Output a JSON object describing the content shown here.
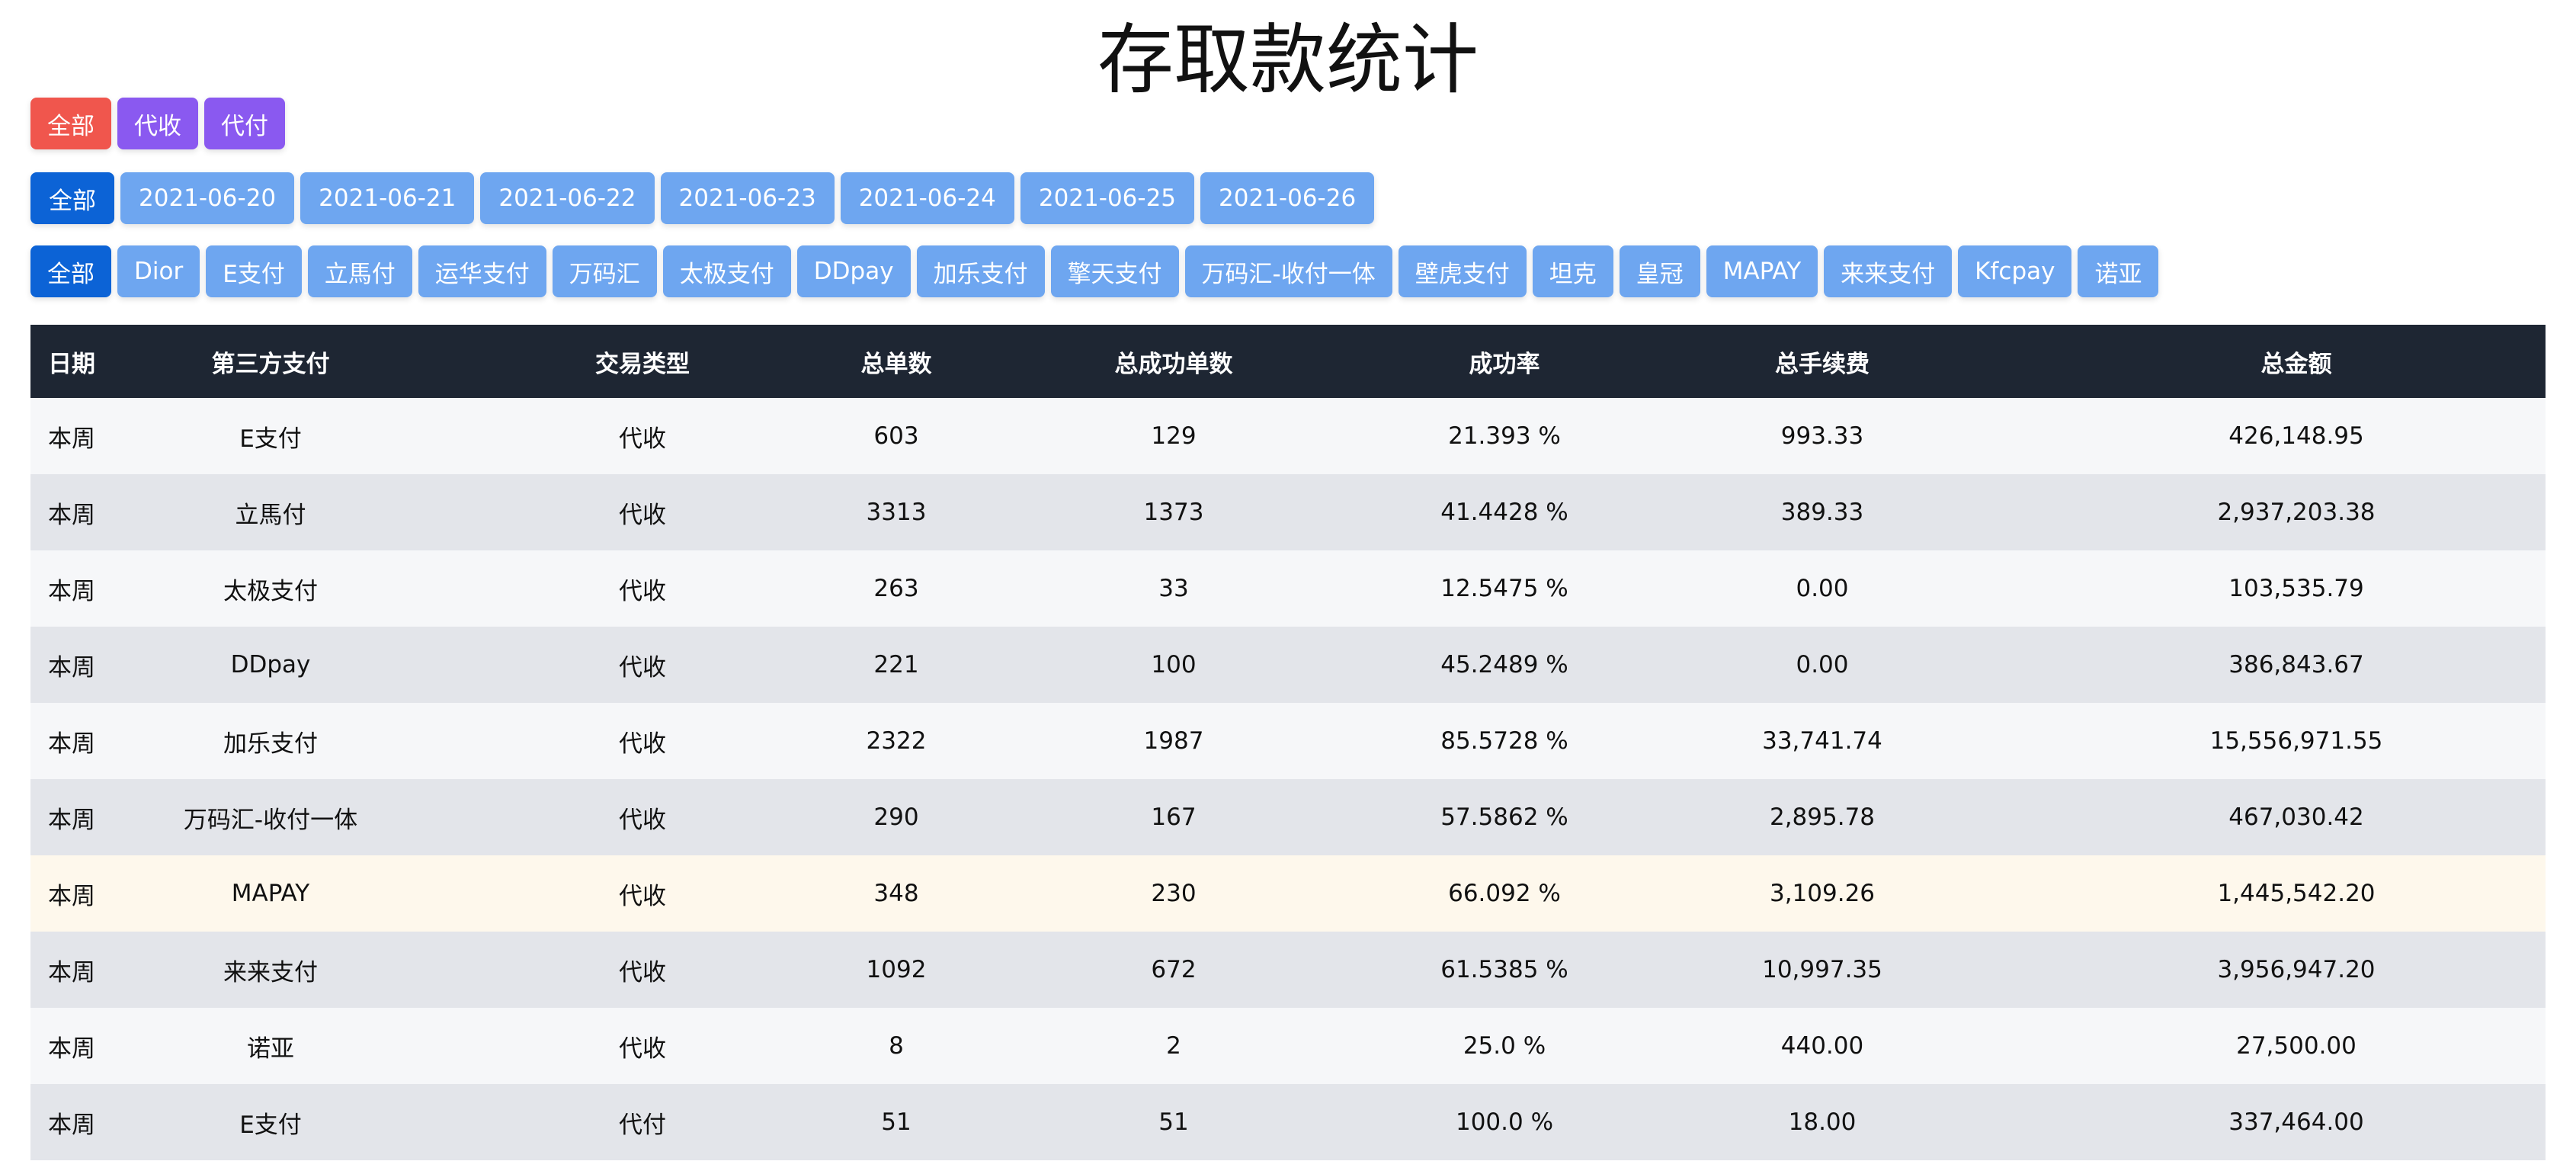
{
  "page": {
    "title": "存取款统计"
  },
  "type_filters": [
    {
      "label": "全部",
      "color": "#f0564d"
    },
    {
      "label": "代收",
      "color": "#8a59f0"
    },
    {
      "label": "代付",
      "color": "#8a59f0"
    }
  ],
  "date_filters": [
    {
      "label": "全部",
      "active": true
    },
    {
      "label": "2021-06-20",
      "active": false
    },
    {
      "label": "2021-06-21",
      "active": false
    },
    {
      "label": "2021-06-22",
      "active": false
    },
    {
      "label": "2021-06-23",
      "active": false
    },
    {
      "label": "2021-06-24",
      "active": false
    },
    {
      "label": "2021-06-25",
      "active": false
    },
    {
      "label": "2021-06-26",
      "active": false
    }
  ],
  "payment_filters": [
    {
      "label": "全部",
      "active": true
    },
    {
      "label": "Dior",
      "active": false
    },
    {
      "label": "E支付",
      "active": false
    },
    {
      "label": "立馬付",
      "active": false
    },
    {
      "label": "运华支付",
      "active": false
    },
    {
      "label": "万码汇",
      "active": false
    },
    {
      "label": "太极支付",
      "active": false
    },
    {
      "label": "DDpay",
      "active": false
    },
    {
      "label": "加乐支付",
      "active": false
    },
    {
      "label": "擎天支付",
      "active": false
    },
    {
      "label": "万码汇-收付一体",
      "active": false
    },
    {
      "label": "壁虎支付",
      "active": false
    },
    {
      "label": "坦克",
      "active": false
    },
    {
      "label": "皇冠",
      "active": false
    },
    {
      "label": "MAPAY",
      "active": false
    },
    {
      "label": "来来支付",
      "active": false
    },
    {
      "label": "Kfcpay",
      "active": false
    },
    {
      "label": "诺亚",
      "active": false
    }
  ],
  "colors": {
    "primary": "#0c63d6",
    "light": "#6ea6f0",
    "header_bg": "#1e2633",
    "row_odd": "#f6f7f9",
    "row_even": "#e3e5ea",
    "row_highlight": "#fef8ec"
  },
  "table": {
    "columns": [
      "日期",
      "第三方支付",
      "交易类型",
      "总单数",
      "总成功单数",
      "成功率",
      "总手续费",
      "总金额"
    ],
    "rows": [
      {
        "cells": [
          "本周",
          "E支付",
          "代收",
          "603",
          "129",
          "21.393 %",
          "993.33",
          "426,148.95"
        ],
        "highlight": false
      },
      {
        "cells": [
          "本周",
          "立馬付",
          "代收",
          "3313",
          "1373",
          "41.4428 %",
          "389.33",
          "2,937,203.38"
        ],
        "highlight": false
      },
      {
        "cells": [
          "本周",
          "太极支付",
          "代收",
          "263",
          "33",
          "12.5475 %",
          "0.00",
          "103,535.79"
        ],
        "highlight": false
      },
      {
        "cells": [
          "本周",
          "DDpay",
          "代收",
          "221",
          "100",
          "45.2489 %",
          "0.00",
          "386,843.67"
        ],
        "highlight": false
      },
      {
        "cells": [
          "本周",
          "加乐支付",
          "代收",
          "2322",
          "1987",
          "85.5728 %",
          "33,741.74",
          "15,556,971.55"
        ],
        "highlight": false
      },
      {
        "cells": [
          "本周",
          "万码汇-收付一体",
          "代收",
          "290",
          "167",
          "57.5862 %",
          "2,895.78",
          "467,030.42"
        ],
        "highlight": false
      },
      {
        "cells": [
          "本周",
          "MAPAY",
          "代收",
          "348",
          "230",
          "66.092 %",
          "3,109.26",
          "1,445,542.20"
        ],
        "highlight": true
      },
      {
        "cells": [
          "本周",
          "来来支付",
          "代收",
          "1092",
          "672",
          "61.5385 %",
          "10,997.35",
          "3,956,947.20"
        ],
        "highlight": false
      },
      {
        "cells": [
          "本周",
          "诺亚",
          "代收",
          "8",
          "2",
          "25.0 %",
          "440.00",
          "27,500.00"
        ],
        "highlight": false
      },
      {
        "cells": [
          "本周",
          "E支付",
          "代付",
          "51",
          "51",
          "100.0 %",
          "18.00",
          "337,464.00"
        ],
        "highlight": false
      }
    ]
  }
}
